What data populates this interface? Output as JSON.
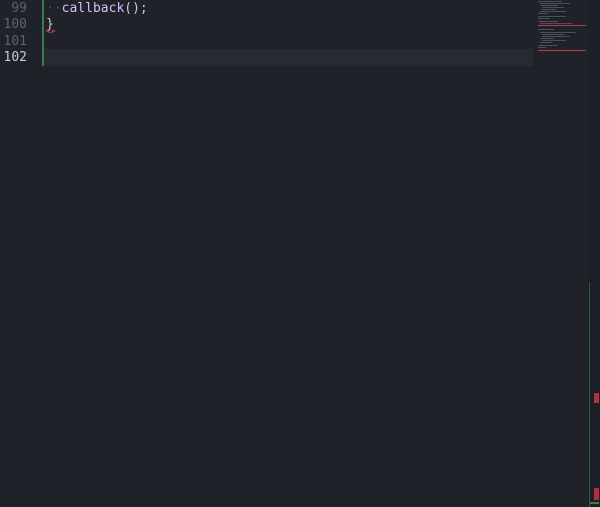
{
  "editor": {
    "line_numbers": [
      "99",
      "100",
      "101",
      "102"
    ],
    "active_line_index": 3,
    "lines": [
      {
        "indent_marker": "··",
        "function_name": "callback",
        "punctuation": "();"
      },
      {
        "text": "}"
      },
      {
        "text": ""
      },
      {
        "text": ""
      }
    ]
  },
  "colors": {
    "background": "#1f2229",
    "function": "#d7bdfc",
    "line_number": "#5c6370",
    "active_line_number": "#c6cad3",
    "git_added": "#3f7a4d",
    "error": "#b3303d"
  }
}
